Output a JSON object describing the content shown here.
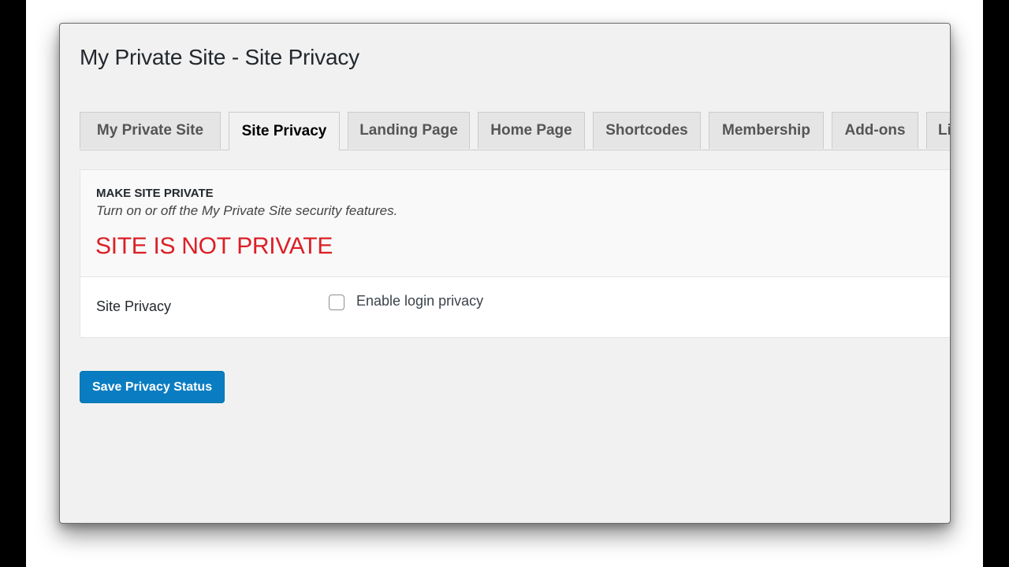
{
  "page": {
    "title": "My Private Site - Site Privacy"
  },
  "tabs": [
    {
      "label": "My Private Site",
      "active": false
    },
    {
      "label": "Site Privacy",
      "active": true
    },
    {
      "label": "Landing Page",
      "active": false
    },
    {
      "label": "Home Page",
      "active": false
    },
    {
      "label": "Shortcodes",
      "active": false
    },
    {
      "label": "Membership",
      "active": false
    },
    {
      "label": "Add-ons",
      "active": false
    },
    {
      "label": "Li",
      "active": false
    }
  ],
  "section": {
    "heading": "MAKE SITE PRIVATE",
    "description": "Turn on or off the My Private Site security features.",
    "status": "SITE IS NOT PRIVATE",
    "status_color": "#dc1f26"
  },
  "settings": {
    "site_privacy": {
      "label": "Site Privacy",
      "checkbox_label": "Enable login privacy",
      "checked": false
    }
  },
  "actions": {
    "save_label": "Save Privacy Status",
    "save_color": "#0a7dc2"
  }
}
